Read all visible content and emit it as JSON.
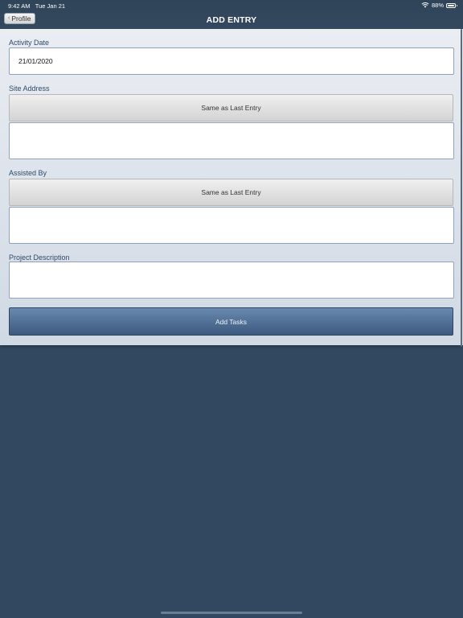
{
  "status_bar": {
    "time": "9:42 AM",
    "date": "Tue Jan 21",
    "battery": "88%",
    "icons": [
      "wifi-icon",
      "battery-icon"
    ]
  },
  "nav": {
    "back_label": "Profile",
    "title": "ADD ENTRY"
  },
  "form": {
    "activity_date_label": "Activity Date",
    "activity_date_value": "21/01/2020",
    "site_address_label": "Site Address",
    "site_address_same_button": "Same as Last Entry",
    "site_address_value": "",
    "assisted_by_label": "Assisted By",
    "assisted_by_same_button": "Same as Last Entry",
    "assisted_by_value": "",
    "project_description_label": "Project Description",
    "project_description_value": "",
    "add_tasks_button": "Add Tasks"
  },
  "colors": {
    "background": "#314860",
    "panel": "#e0e6ed",
    "accent_button": "#4f6e94",
    "label_text": "#2f4a68"
  }
}
